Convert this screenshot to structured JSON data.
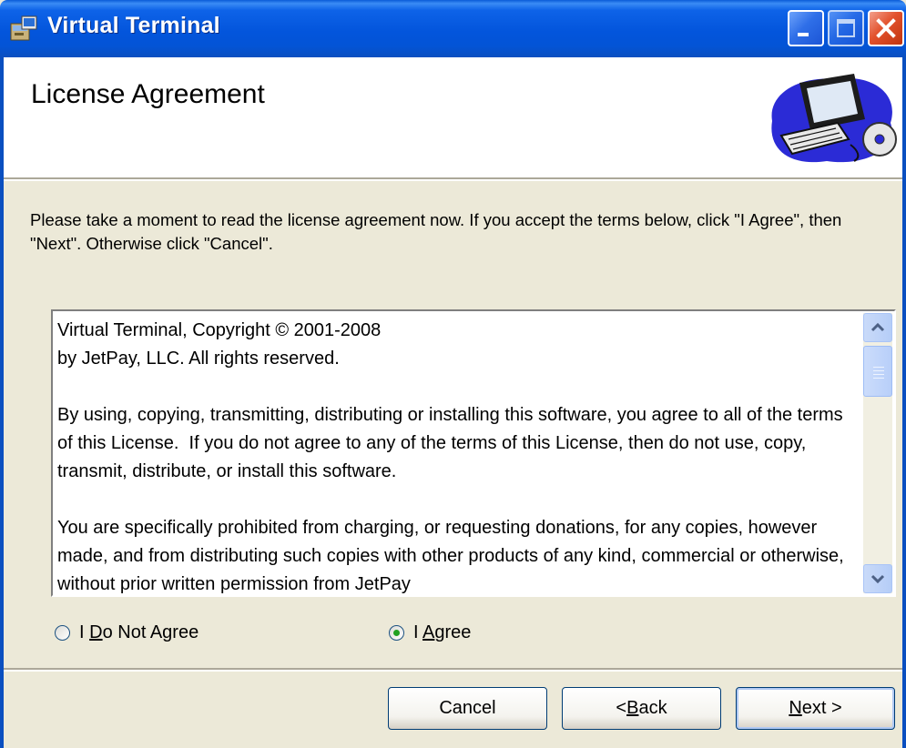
{
  "window": {
    "title": "Virtual Terminal",
    "app_icon": "installer-icon",
    "controls": [
      "minimize",
      "maximize",
      "close"
    ]
  },
  "header": {
    "title": "License Agreement",
    "art": "computer-cd-illustration"
  },
  "instructions": "Please take a moment to read the license agreement now. If you accept the terms below, click \"I Agree\", then \"Next\". Otherwise click \"Cancel\".",
  "license": {
    "paragraphs": [
      "Virtual Terminal, Copyright © 2001-2008\nby JetPay, LLC. All rights reserved.",
      "By using, copying, transmitting, distributing or installing this software, you agree to all of the terms of this License.  If you do not agree to any of the terms of this License, then do not use, copy, transmit, distribute, or install this software.",
      "You are specifically prohibited from charging, or requesting donations, for any copies, however made, and from distributing such copies with other products of any kind, commercial or otherwise, without prior written permission from JetPay"
    ]
  },
  "options": {
    "disagree": {
      "pre": "I ",
      "key": "D",
      "post": "o Not Agree",
      "selected": false
    },
    "agree": {
      "pre": "I ",
      "key": "A",
      "post": "gree",
      "selected": true
    }
  },
  "buttons": {
    "cancel": "Cancel",
    "back": {
      "pre": "< ",
      "key": "B",
      "post": "ack"
    },
    "next": {
      "pre": "",
      "key": "N",
      "post": "ext >"
    }
  },
  "colors": {
    "titlebar": "#0355dc",
    "dialog_bg": "#ece9d8",
    "radio_selected": "#21a121"
  }
}
